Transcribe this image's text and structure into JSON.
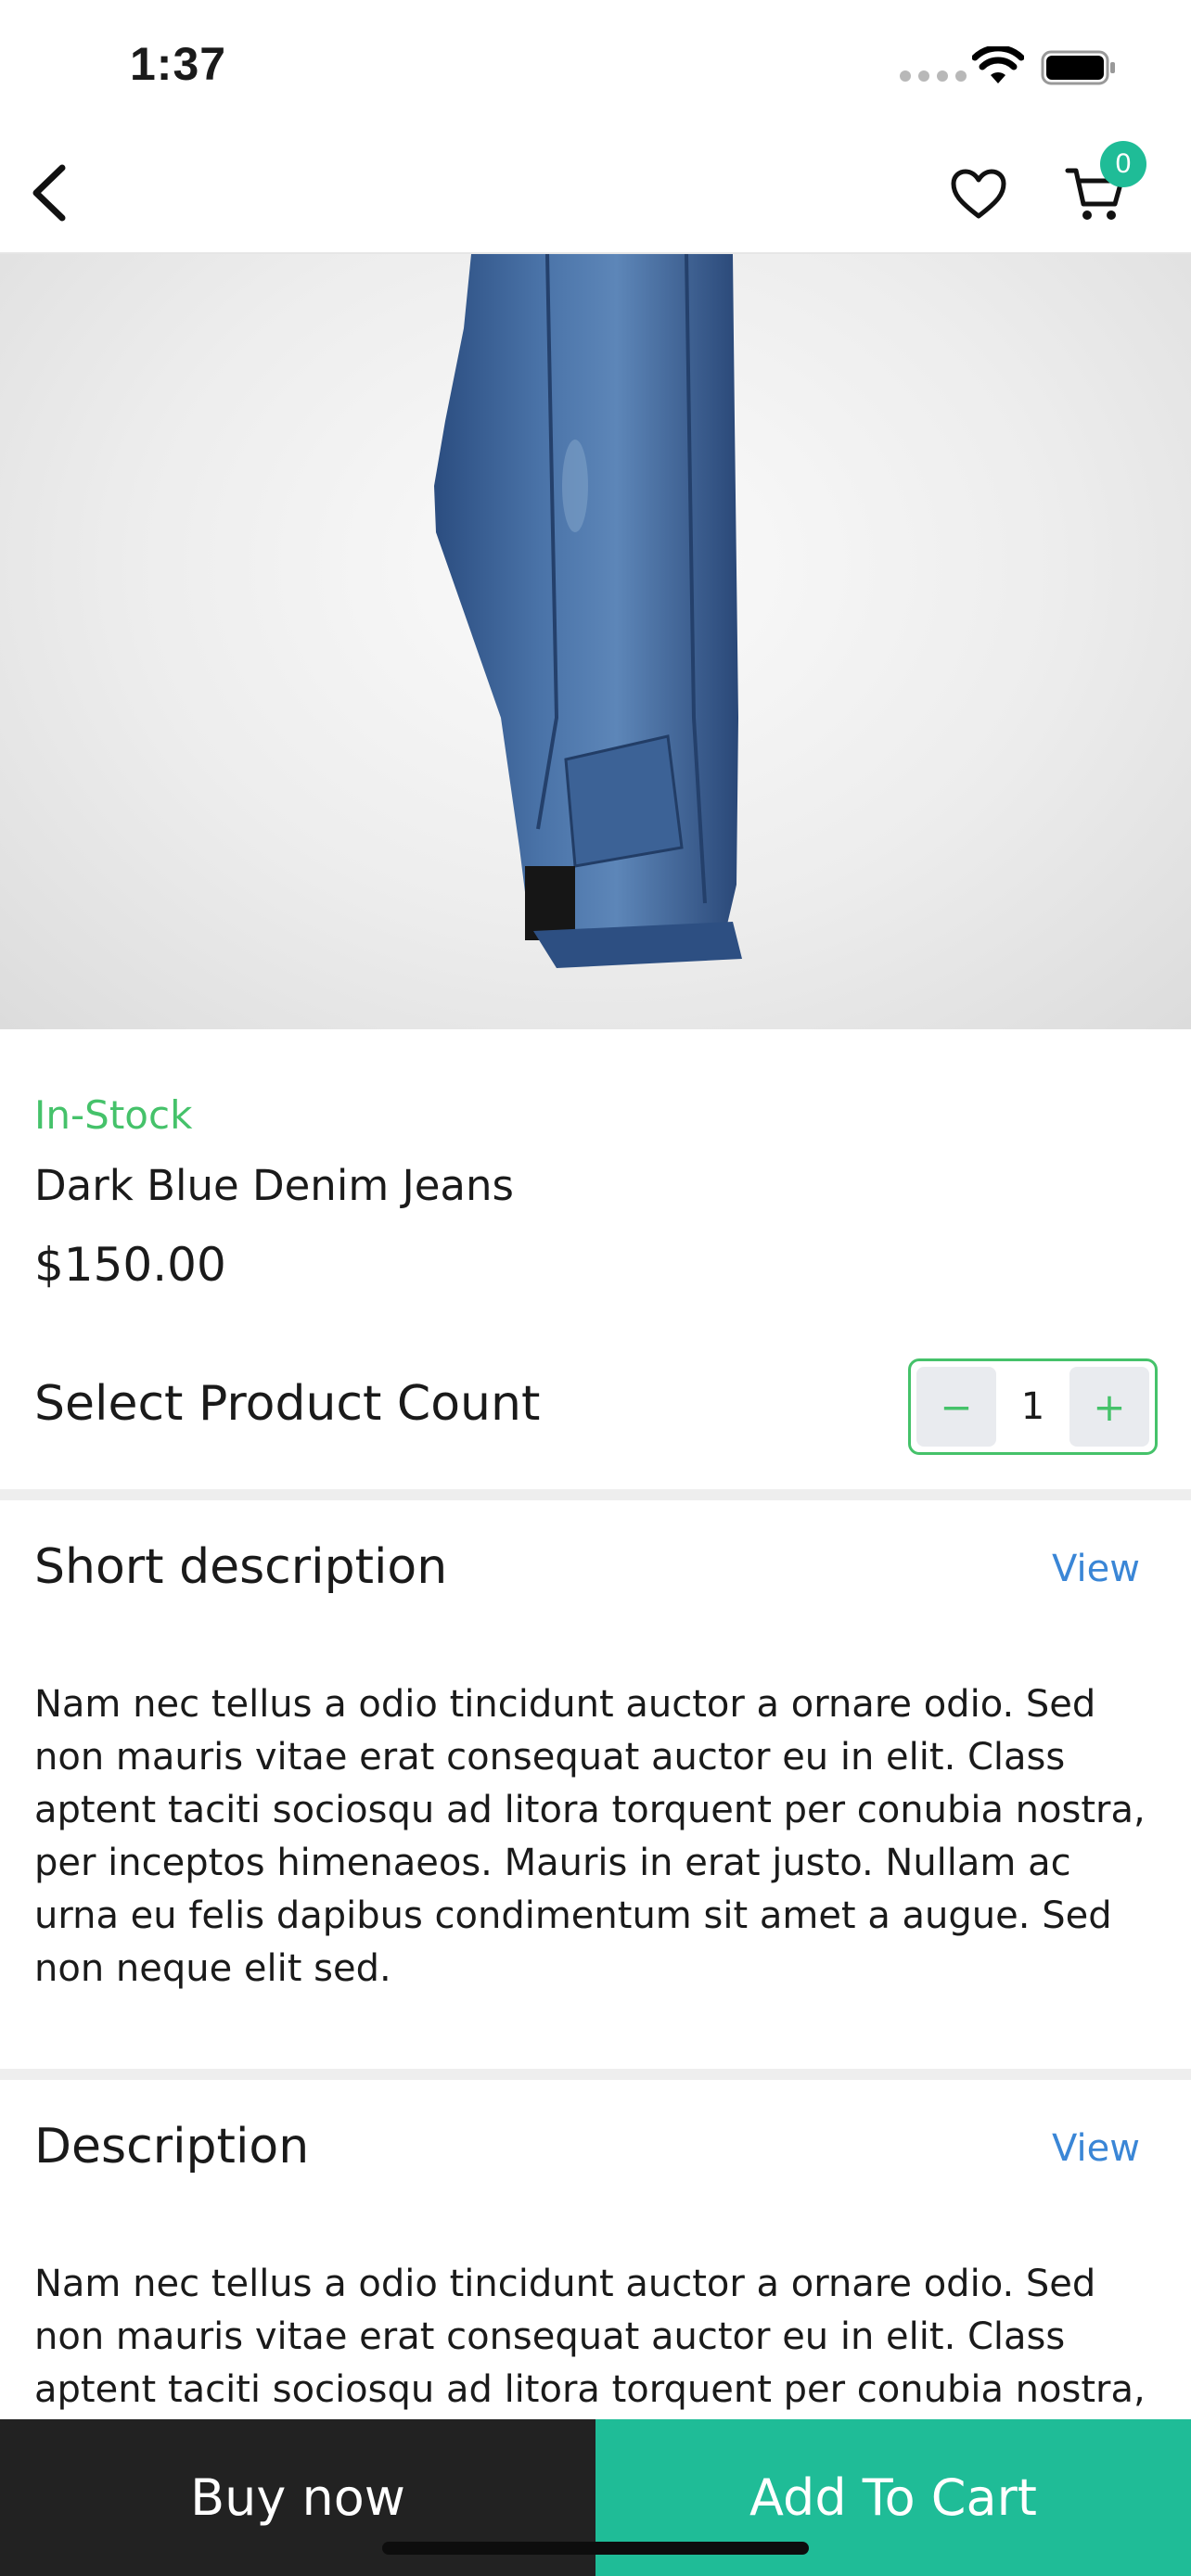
{
  "status_bar": {
    "time": "1:37"
  },
  "nav": {
    "back_icon": "chevron-left-icon",
    "wishlist_icon": "heart-icon",
    "cart_icon": "cart-icon",
    "cart_count": "0"
  },
  "product": {
    "stock_status": "In-Stock",
    "name": "Dark Blue Denim Jeans",
    "price": "$150.00",
    "count_label": "Select Product Count",
    "quantity": "1",
    "minus_symbol": "−",
    "plus_symbol": "+"
  },
  "short_description": {
    "title": "Short description",
    "view_label": "View",
    "text": "Nam nec tellus a odio tincidunt auctor a ornare odio. Sed non mauris vitae erat consequat auctor eu in elit. Class aptent taciti sociosqu ad litora torquent per conubia nostra, per inceptos himenaeos. Mauris in erat justo. Nullam ac urna eu felis dapibus condimentum sit amet a augue. Sed non neque elit sed."
  },
  "description": {
    "title": "Description",
    "view_label": "View",
    "text": "Nam nec tellus a odio tincidunt auctor a ornare odio. Sed non mauris vitae erat consequat auctor eu in elit. Class aptent taciti sociosqu ad litora torquent per conubia nostra, per"
  },
  "actions": {
    "buy_now_label": "Buy now",
    "add_to_cart_label": "Add To Cart"
  },
  "colors": {
    "accent": "#1fbc97",
    "in_stock": "#45c26a",
    "link": "#3a86d6",
    "dark_button": "#222222"
  }
}
